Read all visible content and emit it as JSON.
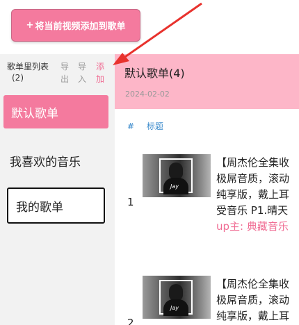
{
  "add_video_button": {
    "label": "将当前视频添加到歌单",
    "plus": "+"
  },
  "sidebar": {
    "title": "歌单里列表",
    "count": "(2)",
    "export_label": "导出",
    "import_label": "导入",
    "add_label": "添加",
    "playlists": [
      {
        "name": "默认歌单"
      },
      {
        "name": "我喜欢的音乐"
      },
      {
        "name": "我的歌单"
      }
    ]
  },
  "main": {
    "title": "默认歌单(4)",
    "date": "2024-02-02",
    "columns": {
      "index": "#",
      "title": "标题"
    },
    "rows": [
      {
        "index": "1",
        "line1": "【周杰伦全集收",
        "line2": "极屌音质，滚动",
        "line3": "纯享版，戴上耳",
        "line4": "受音乐 P1.晴天",
        "uploader": "up主: 典藏音乐",
        "thumb_sign": "Jay"
      },
      {
        "index": "2",
        "line1": "【周杰伦全集收",
        "line2": "极屌音质，滚动",
        "line3": "纯享版，戴上耳",
        "thumb_sign": "Jay"
      }
    ]
  },
  "colors": {
    "accent": "#f47a9e",
    "header_bg": "#fdb6c8",
    "link": "#3c8bcc",
    "arrow": "#e8322d"
  }
}
